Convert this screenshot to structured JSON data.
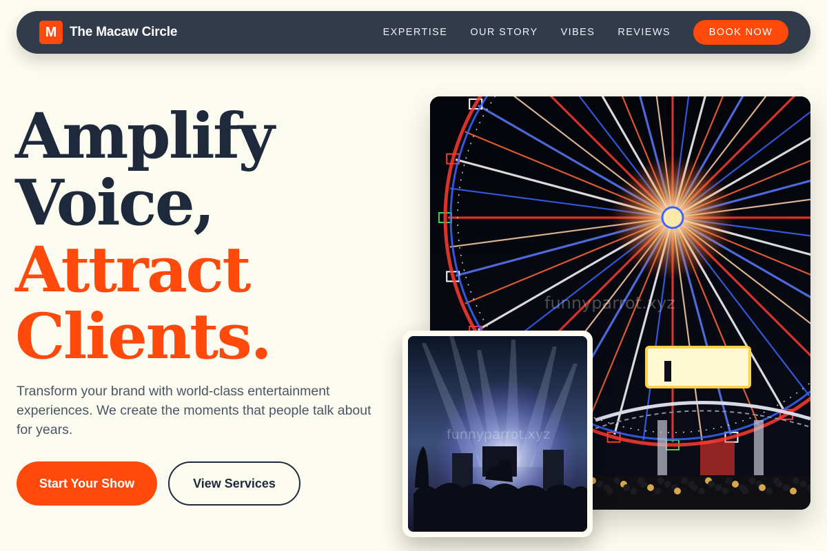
{
  "nav": {
    "logo_letter": "M",
    "brand": "The Macaw Circle",
    "links": [
      "EXPERTISE",
      "OUR STORY",
      "VIBES",
      "REVIEWS"
    ],
    "cta": "BOOK NOW"
  },
  "hero": {
    "headline_line1": "Amplify",
    "headline_line2": "Voice,",
    "headline_line3": "Attract",
    "headline_line4": "Clients.",
    "lead": "Transform your brand with world-class entertainment experiences. We create the moments that people talk about for years.",
    "primary_button": "Start Your Show",
    "secondary_button": "View Services"
  },
  "images": {
    "main_watermark": "funnyparrot.xyz",
    "inset_watermark": "funnyparrot.xyz"
  },
  "colors": {
    "accent": "#ff4a0c",
    "nav_bg": "#323b4a",
    "page_bg": "#fcfbef",
    "heading_dark": "#1e293b"
  }
}
